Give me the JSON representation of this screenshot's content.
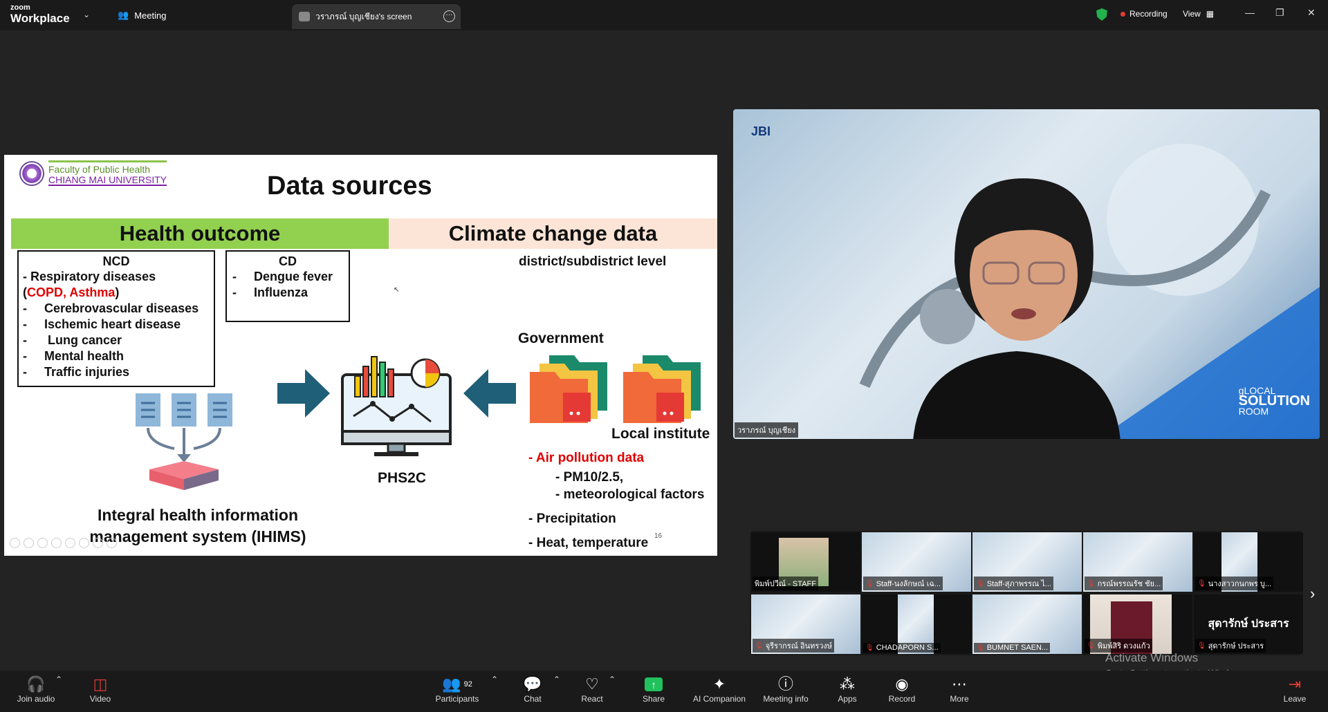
{
  "app": {
    "logo_line1": "zoom",
    "logo_line2": "Workplace",
    "meeting_tab": "Meeting",
    "screen_tab": "วราภรณ์ บุญเชียง's screen",
    "recording": "Recording",
    "view": "View"
  },
  "slide": {
    "logo_line1": "Faculty of Public Health",
    "logo_line2": "CHIANG MAI UNIVERSITY",
    "title": "Data sources",
    "health_header": "Health outcome",
    "climate_header": "Climate change data",
    "ncd_title": "NCD",
    "ncd_items": [
      "-  Respiratory diseases",
      "(",
      "COPD, Asthma",
      ")",
      "-     Cerebrovascular diseases",
      "-     Ischemic heart disease",
      "-      Lung cancer",
      "-     Mental health",
      "-     Traffic injuries"
    ],
    "cd_title": "CD",
    "cd_items": [
      "-     Dengue fever",
      "-     Influenza"
    ],
    "level": "district/subdistrict level",
    "government": "Government",
    "local_institute": "Local institute",
    "air_pollution": "- Air pollution data",
    "pm": "- PM10/2.5,",
    "meteo": "- meteorological factors",
    "precip": "- Precipitation",
    "heat": "- Heat, temperature",
    "page_number": "16",
    "phs2c": "PHS2C",
    "ihims": "Integral health information management system (IHIMS)"
  },
  "speaker": {
    "logo": "JBI",
    "brand_line1": "gLOCAL",
    "brand_line2": "SOLUTION",
    "brand_line3": "ROOM",
    "name": "วราภรณ์ บุญเชียง"
  },
  "gallery": {
    "tiles": [
      {
        "name": "พิมพ์ปวีณ์ - STAFF",
        "muted": false
      },
      {
        "name": "Staff-นงลักษณ์ เฉ...",
        "muted": true
      },
      {
        "name": "Staff-สุภาพรรณ ไ...",
        "muted": true
      },
      {
        "name": "กรณ์พรรณรัช ชัย...",
        "muted": true
      },
      {
        "name": "นางสาวกนกพร บู...",
        "muted": true
      },
      {
        "name": "จุรีรากรณ์ อินทรวงษ์",
        "muted": true
      },
      {
        "name": "CHADAPORN S...",
        "muted": true
      },
      {
        "name": "BUMNET SAEN...",
        "muted": true
      },
      {
        "name": "พิมพ์สิริ ดวงแก้ว",
        "muted": true
      },
      {
        "name": "สุดารักษ์ ประสาร",
        "muted": true,
        "big_name": "สุดารักษ์ ประสาร"
      }
    ],
    "activate_title": "Activate Windows",
    "activate_sub": "Go to Settings to activate Windows."
  },
  "toolbar": {
    "join_audio": "Join audio",
    "video": "Video",
    "participants": "Participants",
    "participants_count": "92",
    "chat": "Chat",
    "react": "React",
    "share": "Share",
    "ai": "AI Companion",
    "meeting_info": "Meeting info",
    "apps": "Apps",
    "record": "Record",
    "more": "More",
    "leave": "Leave"
  },
  "colors": {
    "health_header": "#92d050",
    "climate_header": "#fce4d6",
    "accent_red": "#e00000",
    "share_green": "#21c25e"
  }
}
